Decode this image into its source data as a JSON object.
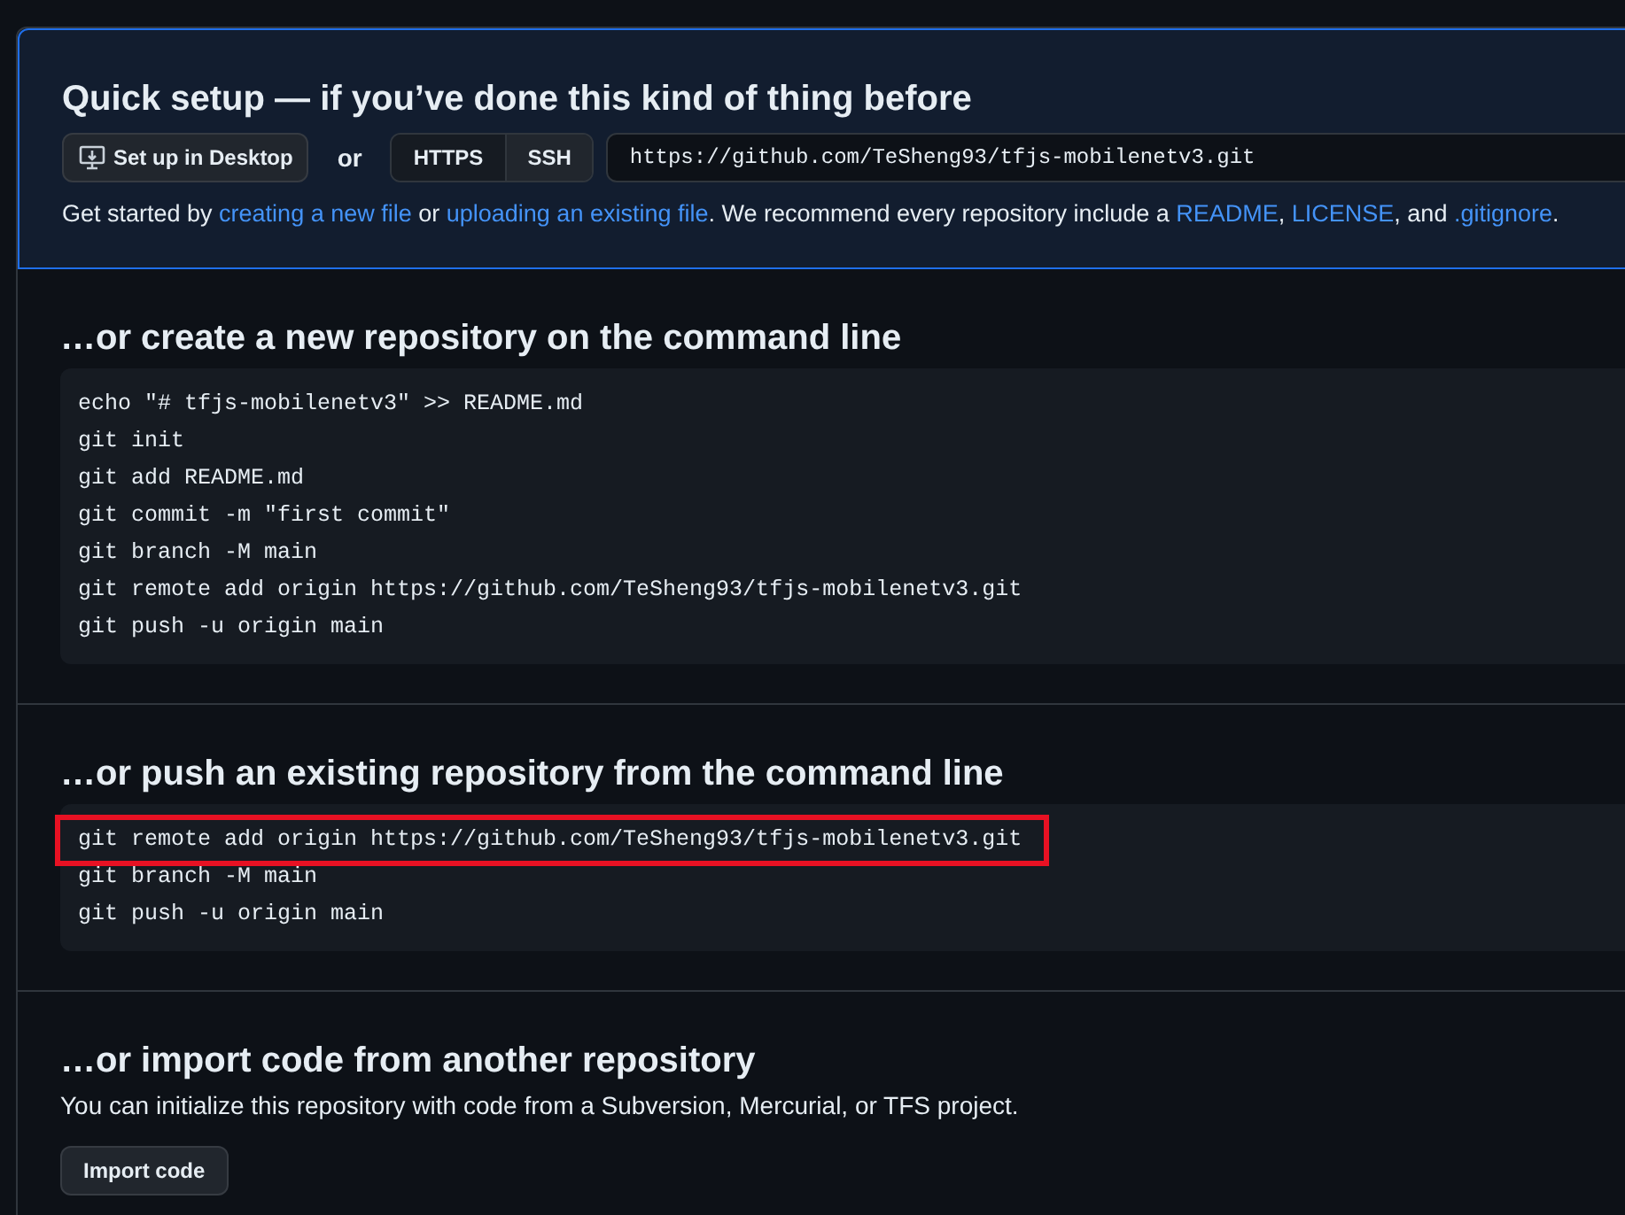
{
  "quick_setup": {
    "title": "Quick setup — if you’ve done this kind of thing before",
    "desktop_button": "Set up in Desktop",
    "or": "or",
    "protocols": [
      {
        "label": "HTTPS",
        "selected": true
      },
      {
        "label": "SSH",
        "selected": false
      }
    ],
    "url": "https://github.com/TeSheng93/tfjs-mobilenetv3.git",
    "help": [
      {
        "text": "Get started by ",
        "kind": "text"
      },
      {
        "text": "creating a new file",
        "kind": "link"
      },
      {
        "text": " or ",
        "kind": "text"
      },
      {
        "text": "uploading an existing file",
        "kind": "link"
      },
      {
        "text": ". We recommend every repository include a ",
        "kind": "text"
      },
      {
        "text": "README",
        "kind": "link"
      },
      {
        "text": ", ",
        "kind": "text"
      },
      {
        "text": "LICENSE",
        "kind": "link"
      },
      {
        "text": ", and ",
        "kind": "text"
      },
      {
        "text": ".gitignore",
        "kind": "link"
      },
      {
        "text": ".",
        "kind": "text"
      }
    ]
  },
  "sections": [
    {
      "kind": "code",
      "title": "…or create a new repository on the command line",
      "lines": [
        {
          "text": "echo \"# tfjs-mobilenetv3\" >> README.md",
          "highlighted": false
        },
        {
          "text": "git init",
          "highlighted": false
        },
        {
          "text": "git add README.md",
          "highlighted": false
        },
        {
          "text": "git commit -m \"first commit\"",
          "highlighted": false
        },
        {
          "text": "git branch -M main",
          "highlighted": false
        },
        {
          "text": "git remote add origin https://github.com/TeSheng93/tfjs-mobilenetv3.git",
          "highlighted": false
        },
        {
          "text": "git push -u origin main",
          "highlighted": false
        }
      ]
    },
    {
      "kind": "code",
      "title": "…or push an existing repository from the command line",
      "lines": [
        {
          "text": "git remote add origin https://github.com/TeSheng93/tfjs-mobilenetv3.git",
          "highlighted": true
        },
        {
          "text": "git branch -M main",
          "highlighted": false
        },
        {
          "text": "git push -u origin main",
          "highlighted": false
        }
      ]
    },
    {
      "kind": "import",
      "title": "…or import code from another repository",
      "description": "You can initialize this repository with code from a Subversion, Mercurial, or TFS project.",
      "button": "Import code"
    }
  ]
}
